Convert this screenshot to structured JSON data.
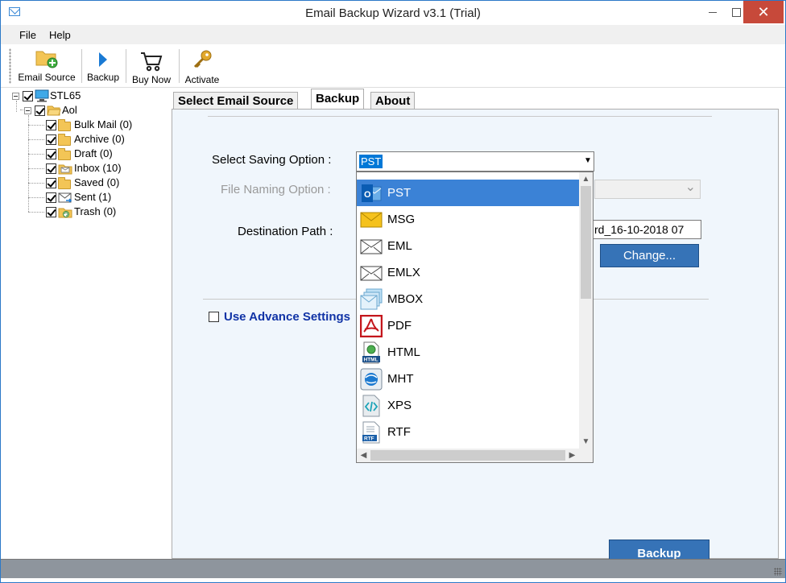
{
  "window": {
    "title": "Email Backup Wizard v3.1 (Trial)",
    "accent": "#3b82d6",
    "close_color": "#c7493a"
  },
  "menu": {
    "file": "File",
    "help": "Help"
  },
  "toolbar": {
    "email_source": "Email Source",
    "backup": "Backup",
    "buy_now": "Buy Now",
    "activate": "Activate"
  },
  "tree": {
    "root": "STL65",
    "account": "Aol",
    "folders": [
      {
        "label": "Bulk Mail (0)",
        "icon": "folder-icon"
      },
      {
        "label": "Archive (0)",
        "icon": "folder-icon"
      },
      {
        "label": "Draft (0)",
        "icon": "folder-icon"
      },
      {
        "label": "Inbox (10)",
        "icon": "inbox-icon"
      },
      {
        "label": "Saved (0)",
        "icon": "folder-icon"
      },
      {
        "label": "Sent (1)",
        "icon": "sent-icon"
      },
      {
        "label": "Trash (0)",
        "icon": "trash-icon"
      }
    ]
  },
  "tabs": {
    "select_email_source": "Select Email Source",
    "backup": "Backup",
    "about": "About"
  },
  "backup_panel": {
    "saving_option_label": "Select Saving Option :",
    "saving_option_value": "PST",
    "file_naming_label": "File Naming Option :",
    "destination_label": "Destination Path :",
    "destination_value": "rd_16-10-2018 07",
    "change_button": "Change...",
    "advance_settings": "Use Advance Settings",
    "backup_button": "Backup"
  },
  "dropdown": {
    "options": [
      {
        "label": "PST",
        "icon": "outlook-icon",
        "selected": true
      },
      {
        "label": "MSG",
        "icon": "envelope-yellow-icon",
        "selected": false
      },
      {
        "label": "EML",
        "icon": "envelope-icon",
        "selected": false
      },
      {
        "label": "EMLX",
        "icon": "envelope-icon",
        "selected": false
      },
      {
        "label": "MBOX",
        "icon": "mbox-icon",
        "selected": false
      },
      {
        "label": "PDF",
        "icon": "pdf-icon",
        "selected": false
      },
      {
        "label": "HTML",
        "icon": "html-icon",
        "selected": false
      },
      {
        "label": "MHT",
        "icon": "mht-icon",
        "selected": false
      },
      {
        "label": "XPS",
        "icon": "xps-icon",
        "selected": false
      },
      {
        "label": "RTF",
        "icon": "rtf-icon",
        "selected": false
      }
    ]
  }
}
